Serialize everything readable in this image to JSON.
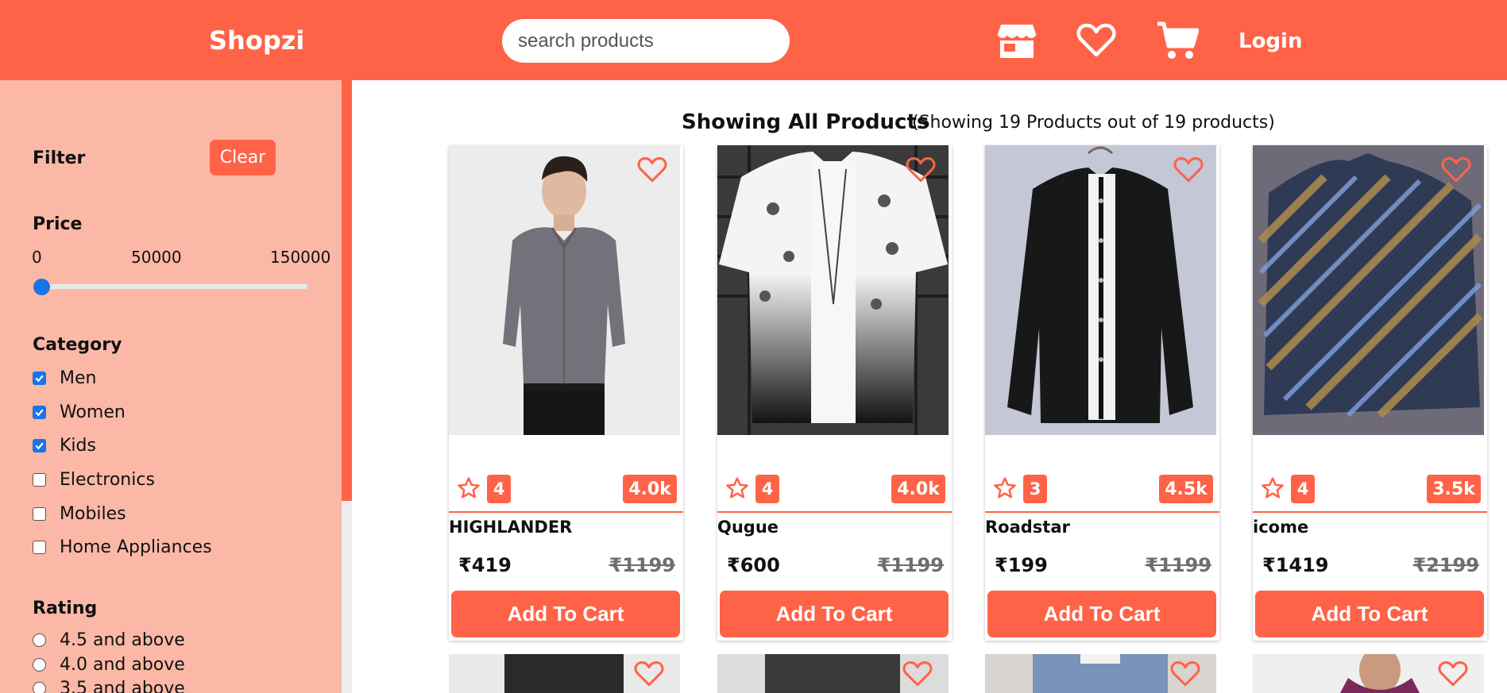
{
  "header": {
    "brand": "Shopzi",
    "search_placeholder": "search products",
    "icons": [
      "store-icon",
      "heart-icon",
      "cart-icon"
    ],
    "login_label": "Login"
  },
  "colors": {
    "accent": "#ff6347",
    "sidebar_bg": "#fcb8a6",
    "checkbox": "#1a73e8"
  },
  "sidebar": {
    "filter_label": "Filter",
    "clear_label": "Clear",
    "price": {
      "title": "Price",
      "labels": [
        "0",
        "50000",
        "150000"
      ],
      "slider_value": 0
    },
    "category": {
      "title": "Category",
      "items": [
        {
          "label": "Men",
          "checked": true
        },
        {
          "label": "Women",
          "checked": true
        },
        {
          "label": "Kids",
          "checked": true
        },
        {
          "label": "Electronics",
          "checked": false
        },
        {
          "label": "Mobiles",
          "checked": false
        },
        {
          "label": "Home Appliances",
          "checked": false
        }
      ]
    },
    "rating": {
      "title": "Rating",
      "items": [
        "4.5 and above",
        "4.0 and above",
        "3.5 and above"
      ]
    }
  },
  "main": {
    "heading": "Showing All Products",
    "subheading": "(Showing 19 Products out of 19 products)",
    "products": [
      {
        "name": "HIGHLANDER",
        "rating": "4",
        "reviews": "4.0k",
        "price": "₹419",
        "mrp": "₹1199",
        "add_label": "Add To Cart"
      },
      {
        "name": "Qugue",
        "rating": "4",
        "reviews": "4.0k",
        "price": "₹600",
        "mrp": "₹1199",
        "add_label": "Add To Cart"
      },
      {
        "name": "Roadstar",
        "rating": "3",
        "reviews": "4.5k",
        "price": "₹199",
        "mrp": "₹1199",
        "add_label": "Add To Cart"
      },
      {
        "name": "icome",
        "rating": "4",
        "reviews": "3.5k",
        "price": "₹1419",
        "mrp": "₹2199",
        "add_label": "Add To Cart"
      }
    ]
  }
}
